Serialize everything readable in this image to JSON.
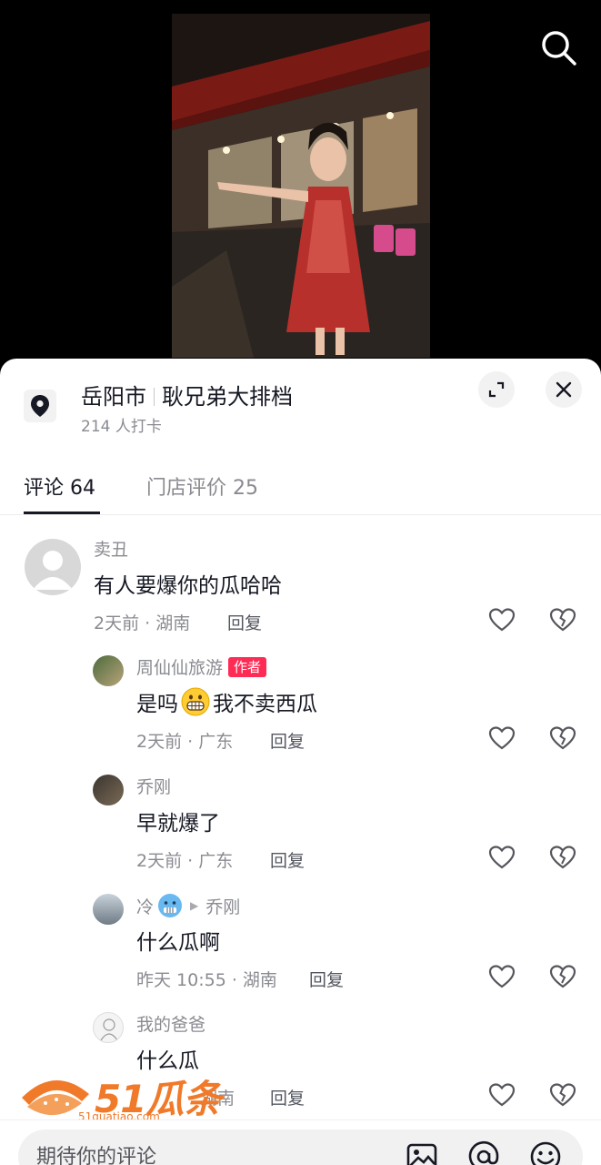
{
  "video": {
    "sign_text": "耿兄弟大排档"
  },
  "location": {
    "city": "岳阳市",
    "shop": "耿兄弟大排档",
    "checkins": "214 人打卡"
  },
  "tabs": [
    {
      "label": "评论 64"
    },
    {
      "label": "门店评价 25"
    }
  ],
  "comments": [
    {
      "name": "卖丑",
      "text": "有人要爆你的瓜哈哈",
      "meta": "2天前 · 湖南",
      "reply": "回复"
    },
    {
      "name": "周仙仙旅游",
      "badge": "作者",
      "text_before": "是吗",
      "text_after": "我不卖西瓜",
      "meta": "2天前 · 广东",
      "reply": "回复"
    },
    {
      "name": "乔刚",
      "text": "早就爆了",
      "meta": "2天前 · 广东",
      "reply": "回复"
    },
    {
      "name": "冷",
      "reply_to": "乔刚",
      "text": "什么瓜啊",
      "meta": "昨天 10:55 · 湖南",
      "reply": "回复"
    },
    {
      "name": "我的爸爸",
      "text": "什么瓜",
      "meta": "湖南",
      "reply": "回复"
    }
  ],
  "watermark": {
    "brand": "51瓜条",
    "url": "51guatiao.com"
  },
  "input": {
    "placeholder": "期待你的评论"
  },
  "icons": {
    "search": "search-icon",
    "pin": "location-pin-icon",
    "expand": "expand-icon",
    "close": "close-icon",
    "like": "heart-icon",
    "dislike": "broken-heart-icon",
    "image": "image-icon",
    "mention": "at-icon",
    "emoji": "emoji-icon"
  }
}
